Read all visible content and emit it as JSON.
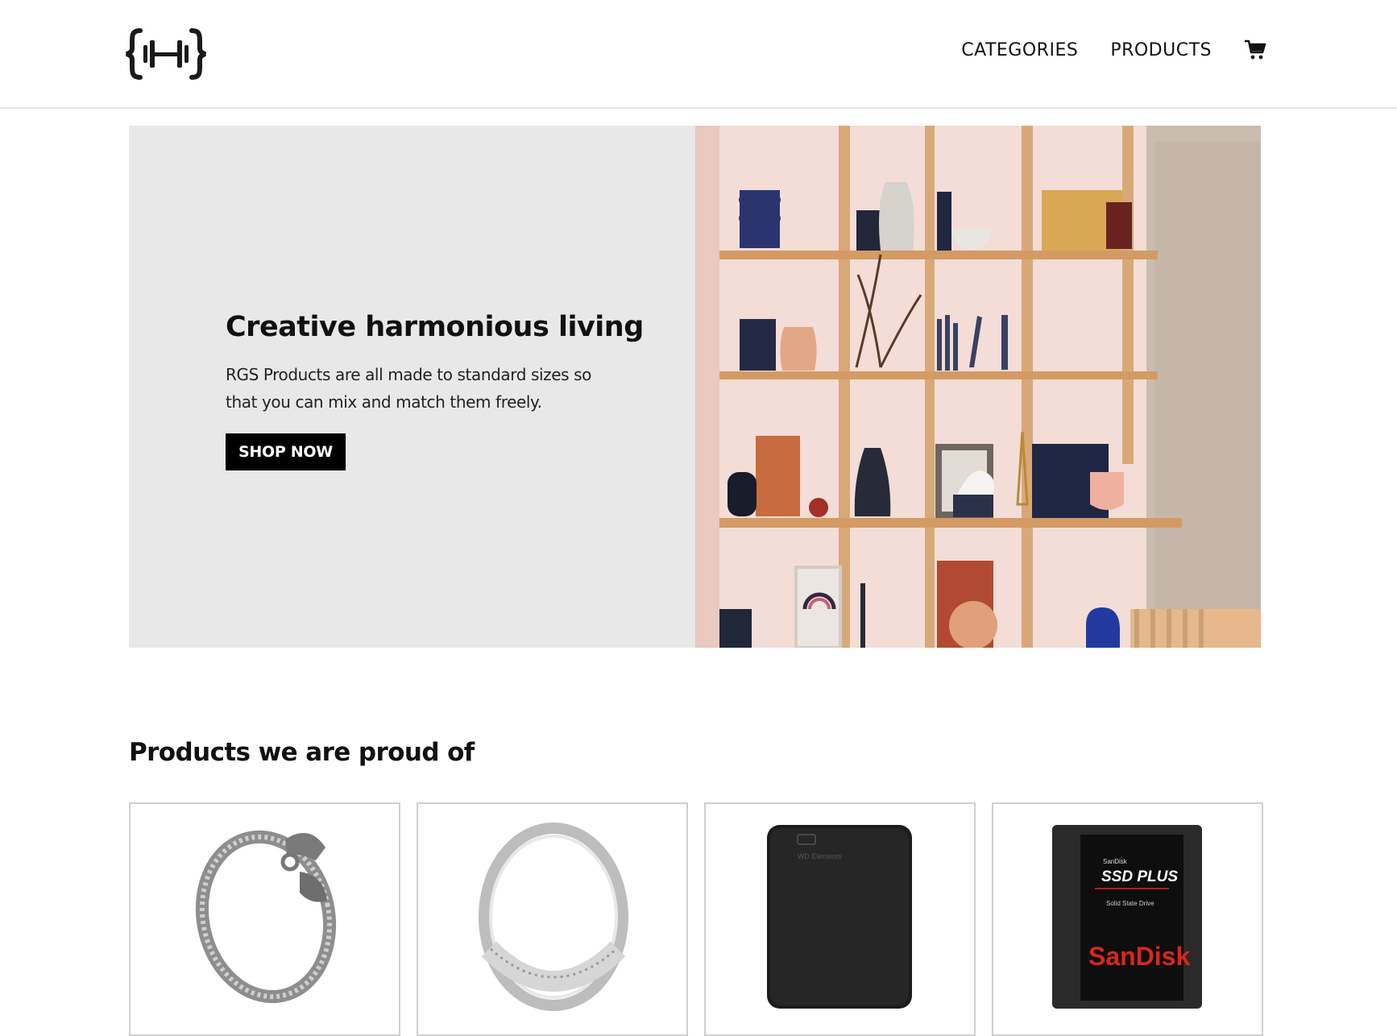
{
  "header": {
    "logo_alt": "logo",
    "nav": [
      {
        "label": "CATEGORIES"
      },
      {
        "label": "PRODUCTS"
      }
    ],
    "cart_icon": "cart-icon"
  },
  "hero": {
    "title": "Creative harmonious living",
    "description": "RGS Products are all made to standard sizes so that you can mix and match them freely.",
    "cta_label": "SHOP NOW",
    "image": "shelf-photo"
  },
  "featured": {
    "title": "Products we are proud of",
    "products": [
      {
        "image": "dragon-bracelet-photo"
      },
      {
        "image": "silver-ring-photo"
      },
      {
        "image": "wd-elements-drive-photo",
        "brand_text": "WD Elements"
      },
      {
        "image": "sandisk-ssd-photo",
        "small_text": "SanDisk",
        "model_text": "SSD PLUS",
        "sub_text": "Solid State Drive",
        "brand_text": "SanDisk"
      }
    ]
  },
  "colors": {
    "hero_bg": "#e8e8e8",
    "button_bg": "#000000",
    "button_text": "#ffffff",
    "sandisk_red": "#d8261c"
  }
}
